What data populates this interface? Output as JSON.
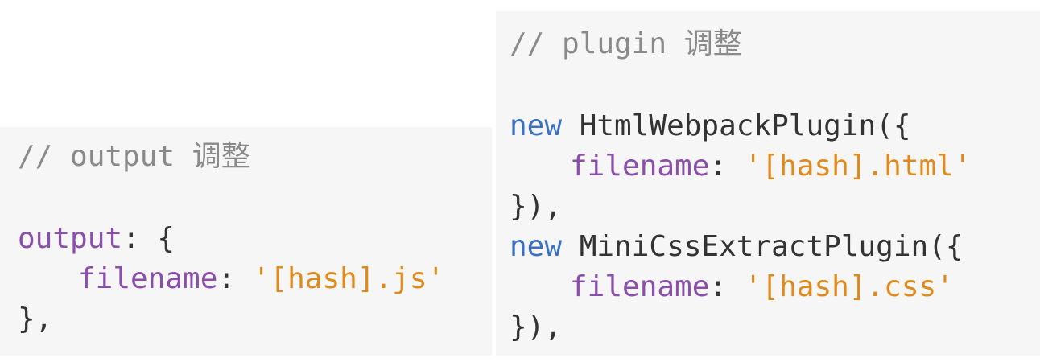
{
  "left_panel": {
    "comment": "// output 调整",
    "lines": [
      {
        "key": "output",
        "punct": ": {"
      },
      {
        "key": "filename",
        "sep": ": ",
        "string": "'[hash].js'"
      },
      {
        "plain": "},"
      }
    ]
  },
  "right_panel": {
    "comment": "// plugin 调整",
    "plugin1": {
      "keyword": "new",
      "name": " HtmlWebpackPlugin({",
      "key": "filename",
      "sep": ": ",
      "string": "'[hash].html'",
      "close": "}),"
    },
    "plugin2": {
      "keyword": "new",
      "name": " MiniCssExtractPlugin({",
      "key": "filename",
      "sep": ": ",
      "string": "'[hash].css'",
      "close": "}),"
    }
  },
  "colors": {
    "panel_bg": "#f6f6f6",
    "comment": "#8a8a8a",
    "key": "#8a4fab",
    "string": "#e08a1e",
    "keyword": "#3b6fc0",
    "text": "#333333"
  }
}
